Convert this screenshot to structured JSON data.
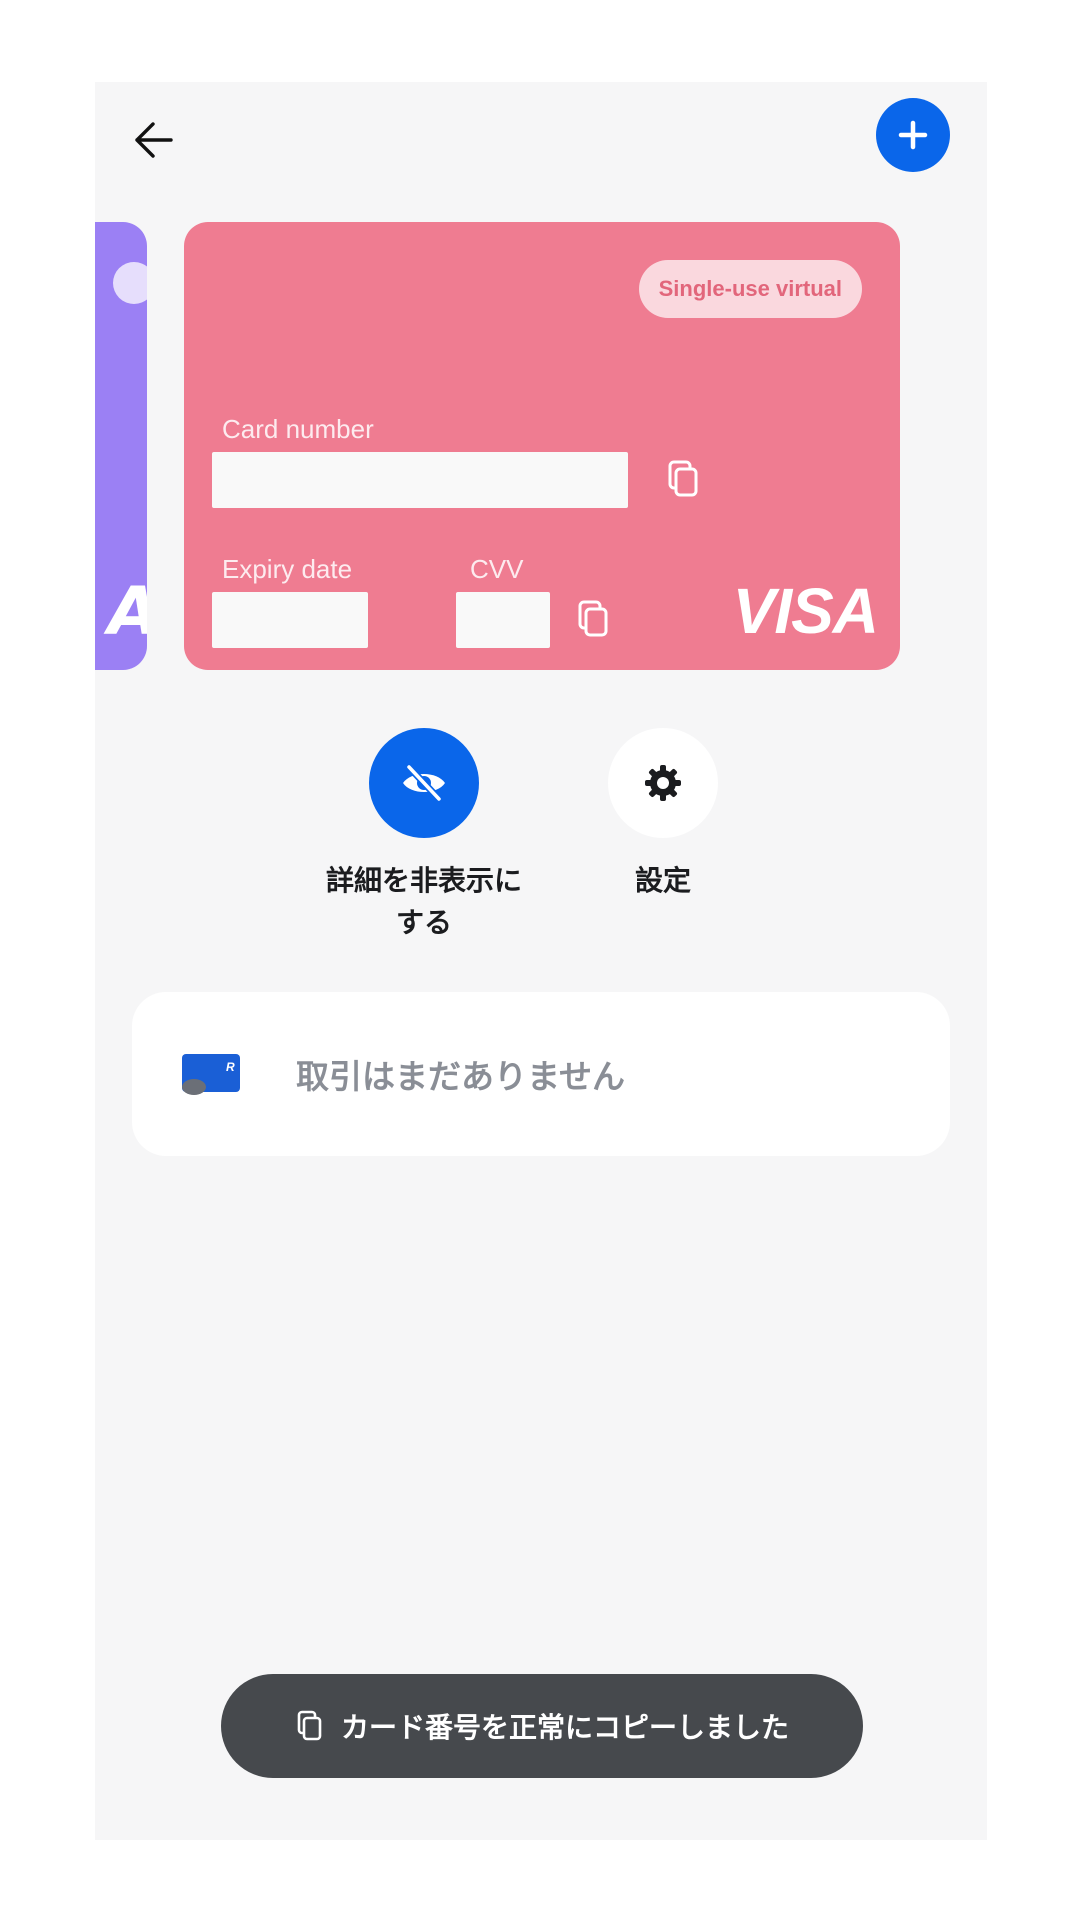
{
  "header": {
    "back_icon": "arrow-left-icon",
    "add_icon": "plus-icon",
    "accent_color": "#0a66ea"
  },
  "previous_card": {
    "color": "#9b80f4",
    "brand_fragment": "A"
  },
  "card": {
    "color": "#ef7c91",
    "badge": "Single-use virtual",
    "card_number_label": "Card number",
    "expiry_label": "Expiry date",
    "cvv_label": "CVV",
    "brand": "VISA",
    "copy_icon": "copy-icon"
  },
  "actions": [
    {
      "label": "詳細を非表示にする",
      "icon": "eye-off-icon",
      "active": true
    },
    {
      "label": "設定",
      "icon": "gear-icon",
      "active": false
    }
  ],
  "transactions": {
    "empty_text": "取引はまだありません"
  },
  "toast": {
    "text": "カード番号を正常にコピーしました",
    "icon": "copy-icon"
  }
}
